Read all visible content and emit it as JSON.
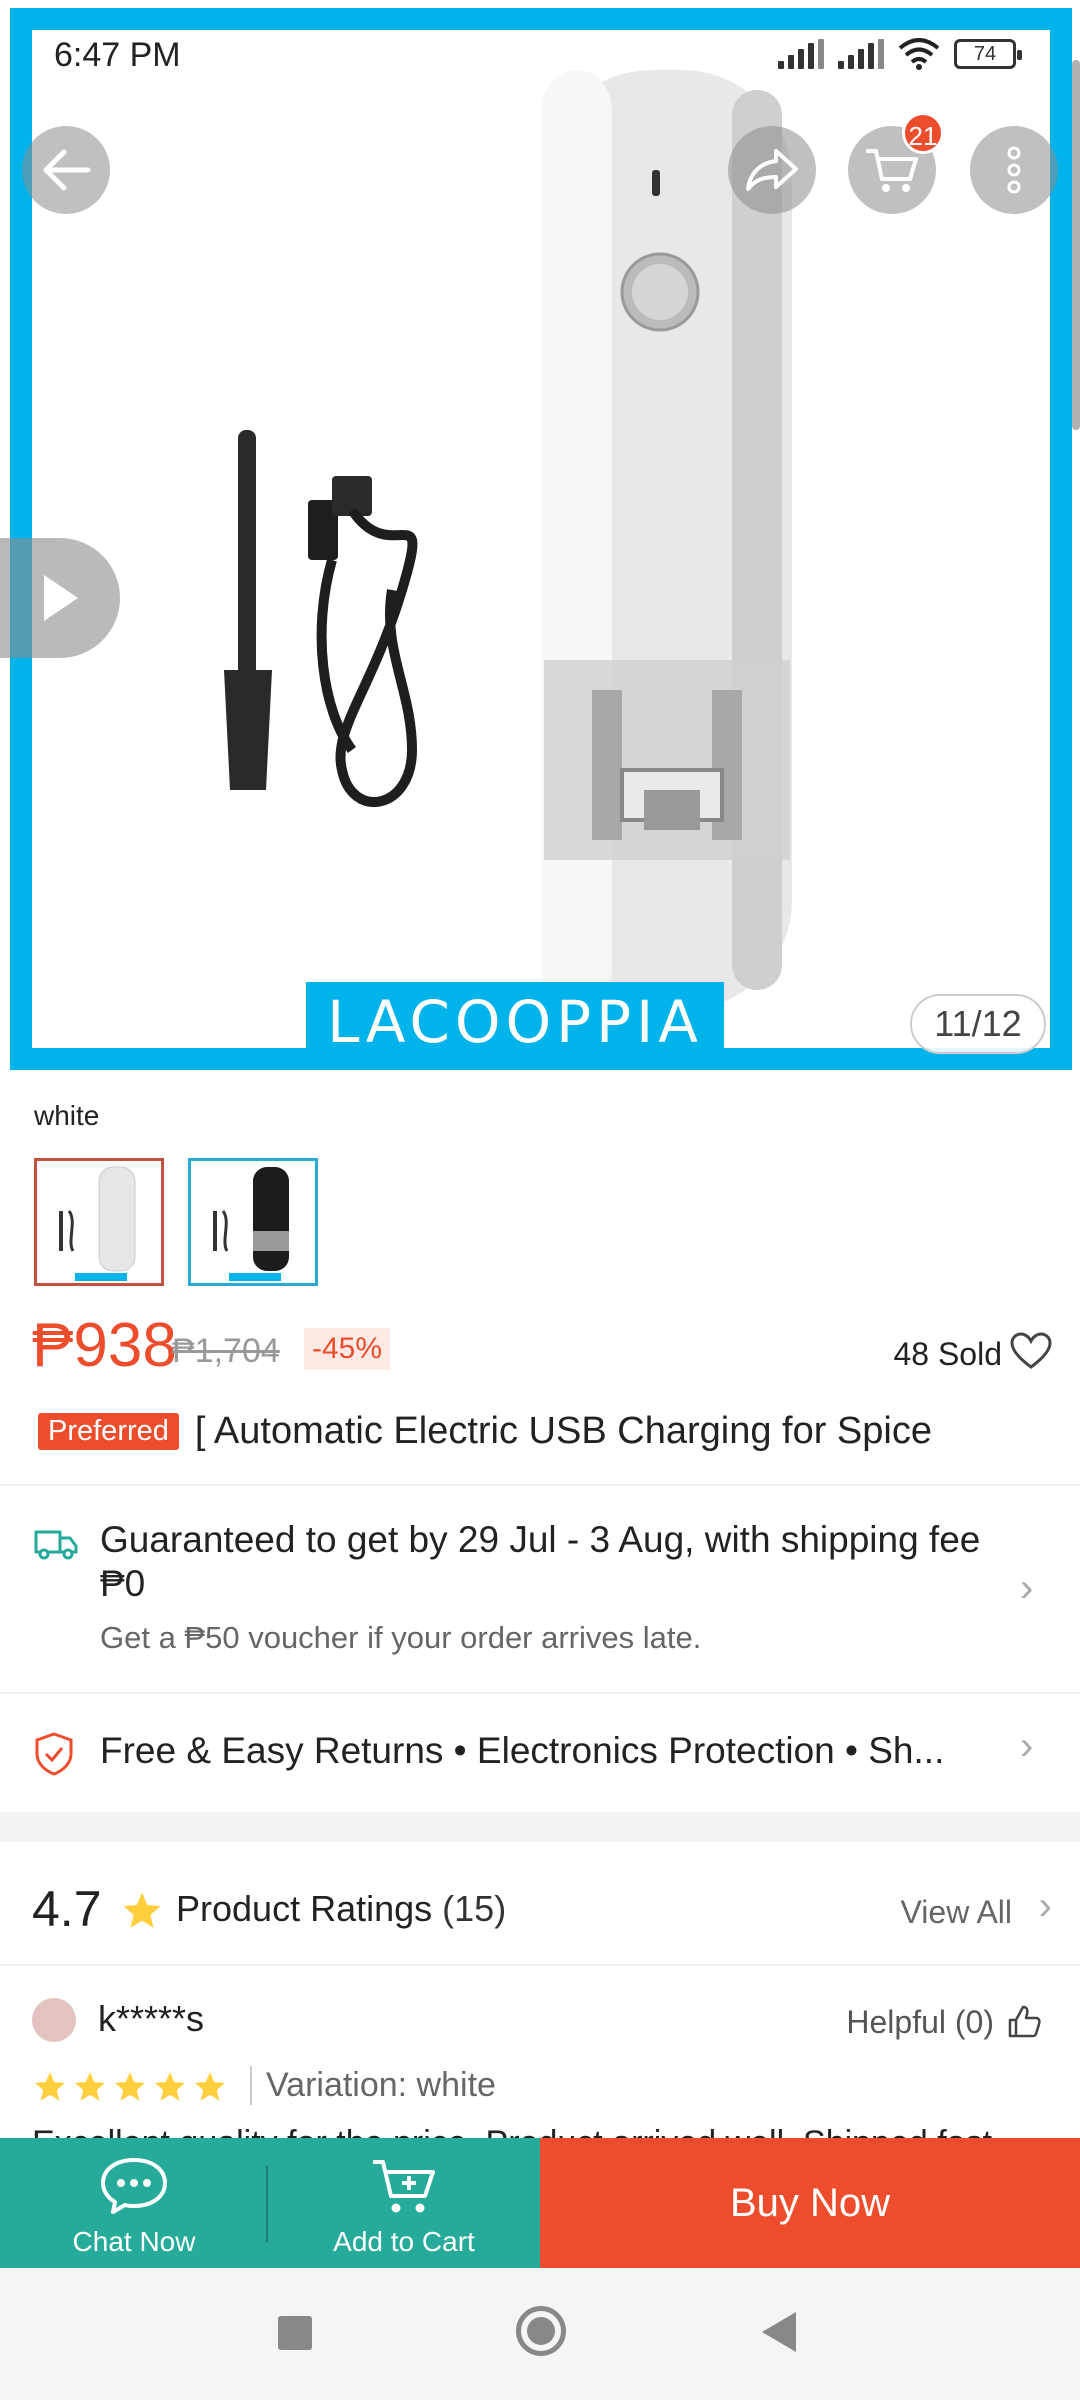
{
  "status_bar": {
    "time": "6:47 PM",
    "battery": "74"
  },
  "hero": {
    "brand": "LACOOPPIA",
    "image_counter": "11/12",
    "cart_badge": "21"
  },
  "variation": {
    "selected_label": "white",
    "options": [
      "white",
      "black"
    ]
  },
  "price": {
    "current": "₱938",
    "original": "₱1,704",
    "discount": "-45%",
    "sold": "48 Sold"
  },
  "product": {
    "badge": "Preferred",
    "title": "[ Automatic Electric USB Charging for Spice"
  },
  "shipping": {
    "guarantee": "Guaranteed to get by 29 Jul - 3 Aug, with shipping fee ₱0",
    "voucher_note": "Get a ₱50 voucher if your order arrives late."
  },
  "returns": {
    "text": "Free & Easy Returns  •  Electronics Protection  •  Sh..."
  },
  "ratings": {
    "score": "4.7",
    "title": "Product Ratings",
    "count": "(15)",
    "view_all": "View All"
  },
  "review": {
    "author": "k*****s",
    "helpful": "Helpful (0)",
    "stars": 5,
    "variation": "Variation: white",
    "text": "Excellent quality for the price. Product arrived well. Shipped fast"
  },
  "bottom_bar": {
    "chat_label": "Chat Now",
    "add_cart_label": "Add to Cart",
    "buy_now_label": "Buy Now"
  },
  "colors": {
    "accent": "#ee4d2d",
    "teal": "#26aa99",
    "frame": "#00b3ea"
  }
}
